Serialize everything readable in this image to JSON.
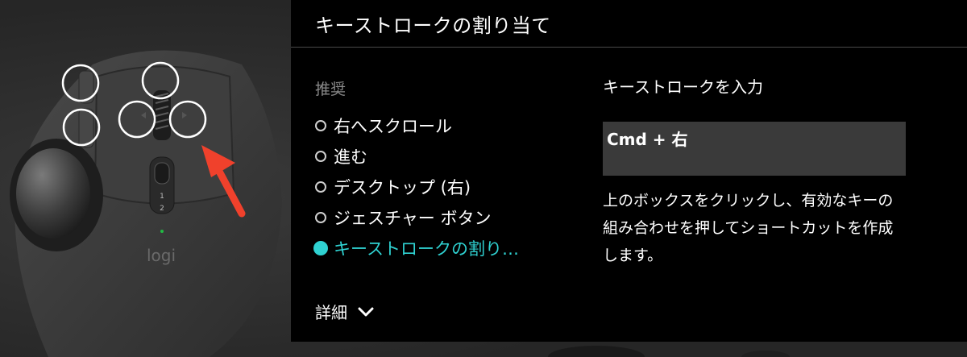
{
  "panel": {
    "title": "キーストロークの割り当て",
    "recommended_label": "推奨",
    "options": [
      {
        "label": "右へスクロール",
        "selected": false
      },
      {
        "label": "進む",
        "selected": false
      },
      {
        "label": "デスクトップ (右)",
        "selected": false
      },
      {
        "label": "ジェスチャー ボタン",
        "selected": false
      },
      {
        "label": "キーストロークの割り…",
        "selected": true
      }
    ],
    "details_label": "詳細",
    "keystroke_heading": "キーストロークを入力",
    "keystroke_value": "Cmd + 右",
    "help_text": "上のボックスをクリックし、有効なキーの組み合わせを押してショートカットを作成します。"
  },
  "mouse": {
    "logo_text": "logi",
    "dpi_mark_1": "1",
    "dpi_mark_2": "2"
  },
  "colors": {
    "accent": "#2fd2d2",
    "arrow": "#f0412c",
    "panel_bg": "#000000",
    "input_bg": "#3a3a3a"
  }
}
